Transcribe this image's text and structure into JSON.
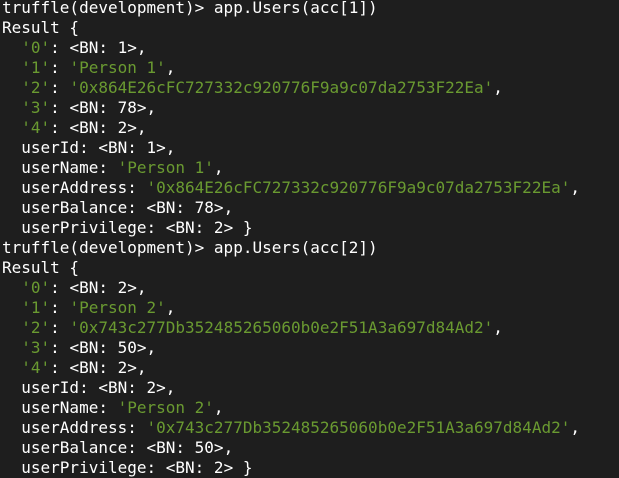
{
  "colors": {
    "background": "#1e1e1e",
    "text": "#ffffff",
    "string": "#6a9a31"
  },
  "blocks": [
    {
      "prompt": "truffle(development)> ",
      "command": "app.Users(acc[1])",
      "result_open": "Result {",
      "lines": [
        {
          "indent": "  ",
          "key": "'0'",
          "sep": ": ",
          "value": "<BN: 1>",
          "value_is_string": false,
          "tail": ","
        },
        {
          "indent": "  ",
          "key": "'1'",
          "sep": ": ",
          "value": "'Person 1'",
          "value_is_string": true,
          "tail": ","
        },
        {
          "indent": "  ",
          "key": "'2'",
          "sep": ": ",
          "value": "'0x864E26cFC727332c920776F9a9c07da2753F22Ea'",
          "value_is_string": true,
          "tail": ","
        },
        {
          "indent": "  ",
          "key": "'3'",
          "sep": ": ",
          "value": "<BN: 78>",
          "value_is_string": false,
          "tail": ","
        },
        {
          "indent": "  ",
          "key": "'4'",
          "sep": ": ",
          "value": "<BN: 2>",
          "value_is_string": false,
          "tail": ","
        },
        {
          "indent": "  ",
          "key": "userId",
          "sep": ": ",
          "value": "<BN: 1>",
          "value_is_string": false,
          "tail": ","
        },
        {
          "indent": "  ",
          "key": "userName",
          "sep": ": ",
          "value": "'Person 1'",
          "value_is_string": true,
          "tail": ","
        },
        {
          "indent": "  ",
          "key": "userAddress",
          "sep": ": ",
          "value": "'0x864E26cFC727332c920776F9a9c07da2753F22Ea'",
          "value_is_string": true,
          "tail": ","
        },
        {
          "indent": "  ",
          "key": "userBalance",
          "sep": ": ",
          "value": "<BN: 78>",
          "value_is_string": false,
          "tail": ","
        },
        {
          "indent": "  ",
          "key": "userPrivilege",
          "sep": ": ",
          "value": "<BN: 2>",
          "value_is_string": false,
          "tail": " }"
        }
      ]
    },
    {
      "prompt": "truffle(development)> ",
      "command": "app.Users(acc[2])",
      "result_open": "Result {",
      "lines": [
        {
          "indent": "  ",
          "key": "'0'",
          "sep": ": ",
          "value": "<BN: 2>",
          "value_is_string": false,
          "tail": ","
        },
        {
          "indent": "  ",
          "key": "'1'",
          "sep": ": ",
          "value": "'Person 2'",
          "value_is_string": true,
          "tail": ","
        },
        {
          "indent": "  ",
          "key": "'2'",
          "sep": ": ",
          "value": "'0x743c277Db352485265060b0e2F51A3a697d84Ad2'",
          "value_is_string": true,
          "tail": ","
        },
        {
          "indent": "  ",
          "key": "'3'",
          "sep": ": ",
          "value": "<BN: 50>",
          "value_is_string": false,
          "tail": ","
        },
        {
          "indent": "  ",
          "key": "'4'",
          "sep": ": ",
          "value": "<BN: 2>",
          "value_is_string": false,
          "tail": ","
        },
        {
          "indent": "  ",
          "key": "userId",
          "sep": ": ",
          "value": "<BN: 2>",
          "value_is_string": false,
          "tail": ","
        },
        {
          "indent": "  ",
          "key": "userName",
          "sep": ": ",
          "value": "'Person 2'",
          "value_is_string": true,
          "tail": ","
        },
        {
          "indent": "  ",
          "key": "userAddress",
          "sep": ": ",
          "value": "'0x743c277Db352485265060b0e2F51A3a697d84Ad2'",
          "value_is_string": true,
          "tail": ","
        },
        {
          "indent": "  ",
          "key": "userBalance",
          "sep": ": ",
          "value": "<BN: 50>",
          "value_is_string": false,
          "tail": ","
        },
        {
          "indent": "  ",
          "key": "userPrivilege",
          "sep": ": ",
          "value": "<BN: 2>",
          "value_is_string": false,
          "tail": " }"
        }
      ]
    }
  ]
}
